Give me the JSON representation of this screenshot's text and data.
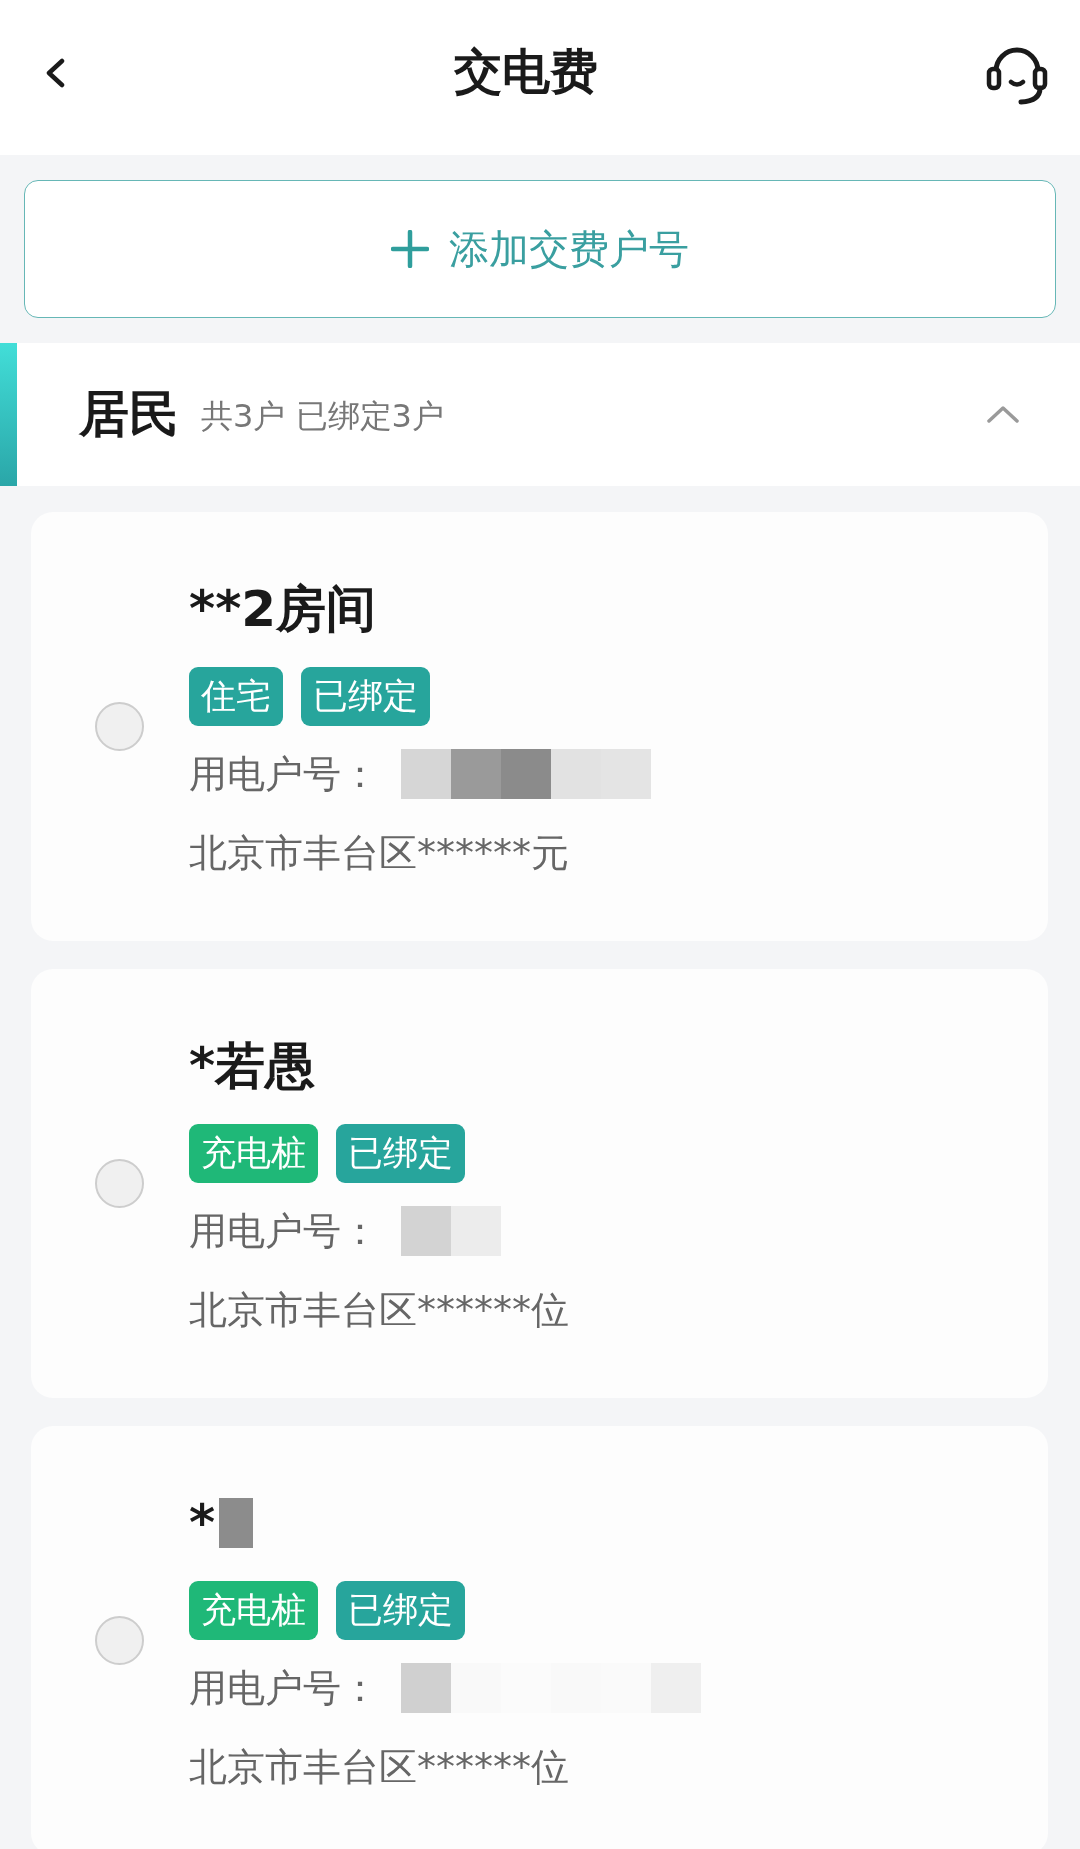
{
  "header": {
    "title": "交电费"
  },
  "add_account_button": {
    "label": "添加交费户号"
  },
  "section": {
    "title": "居民",
    "summary": "共3户 已绑定3户",
    "expanded": true,
    "accounts": [
      {
        "name": "**2房间",
        "name_masked": false,
        "selected": false,
        "tags": [
          {
            "label": "住宅",
            "color": "#27a59c"
          },
          {
            "label": "已绑定",
            "color": "#27a59c"
          }
        ],
        "account_label": "用电户号：",
        "account_masked": true,
        "address": "北京市丰台区******元"
      },
      {
        "name": "*若愚",
        "name_masked": false,
        "selected": false,
        "tags": [
          {
            "label": "充电桩",
            "color": "#1fb878"
          },
          {
            "label": "已绑定",
            "color": "#27a59c"
          }
        ],
        "account_label": "用电户号：",
        "account_masked": true,
        "address": "北京市丰台区******位"
      },
      {
        "name": "*",
        "name_masked": true,
        "selected": false,
        "tags": [
          {
            "label": "充电桩",
            "color": "#1fb878"
          },
          {
            "label": "已绑定",
            "color": "#27a59c"
          }
        ],
        "account_label": "用电户号：",
        "account_masked": true,
        "address": "北京市丰台区******位"
      }
    ]
  }
}
